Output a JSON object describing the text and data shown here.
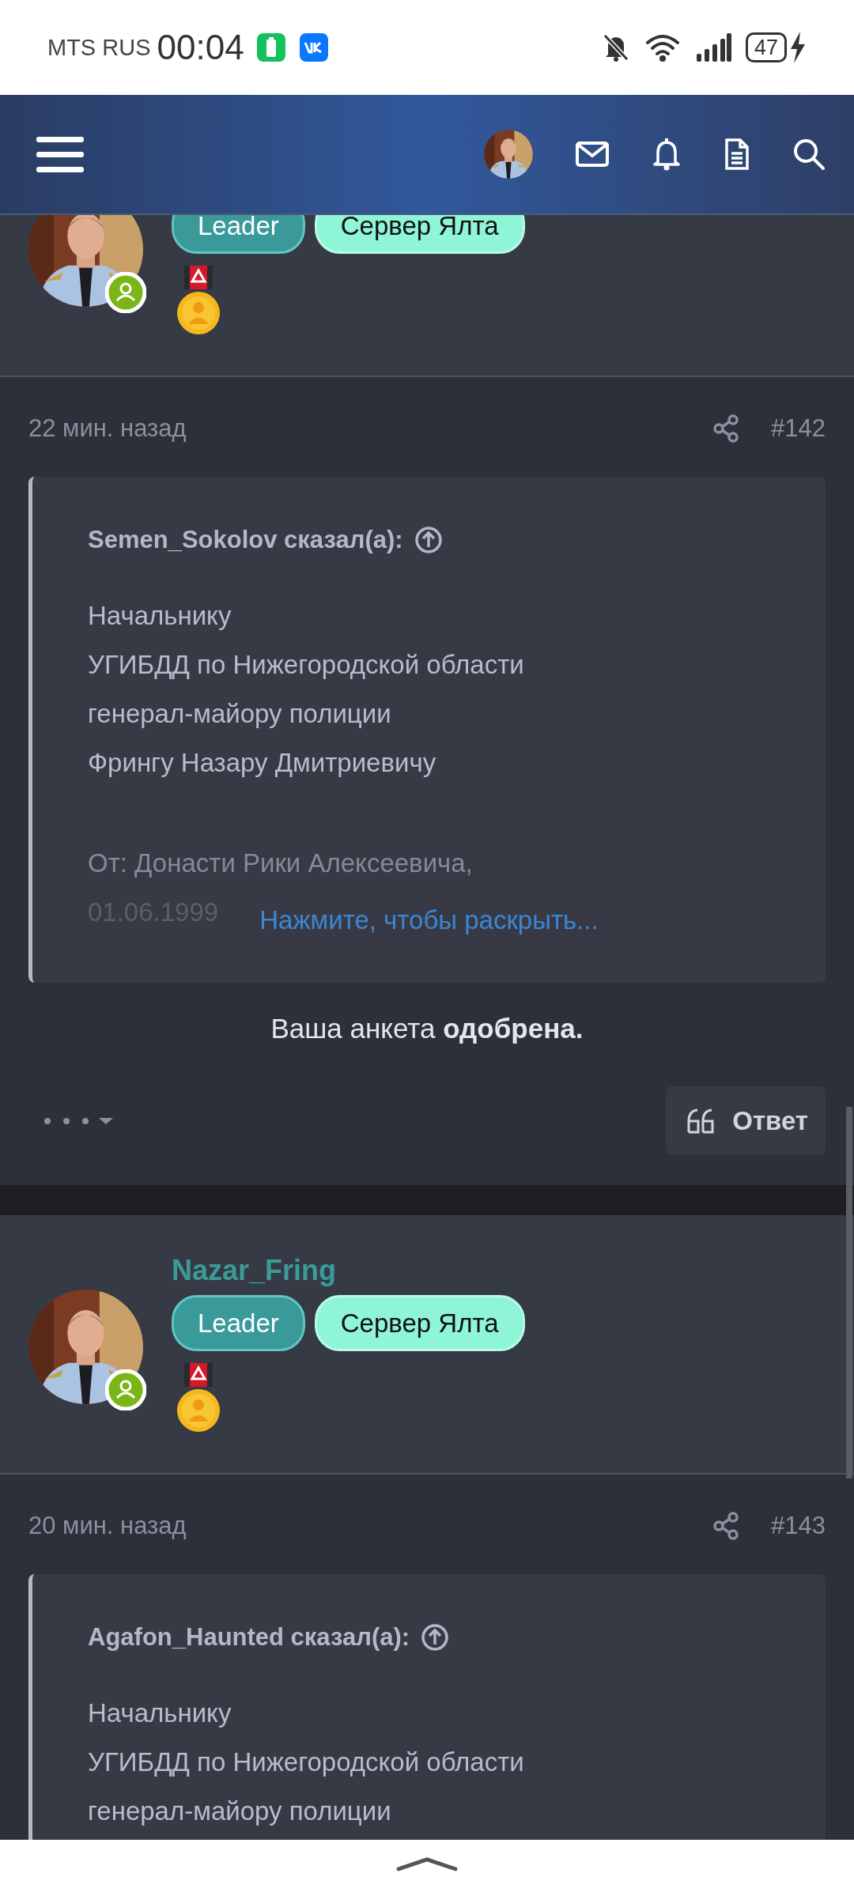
{
  "status_bar": {
    "carrier": "MTS RUS",
    "time": "00:04",
    "battery": "47"
  },
  "posts": [
    {
      "user": {
        "badges": [
          {
            "label": "Leader",
            "kind": "role"
          },
          {
            "label": "Сервер Ялта",
            "kind": "server"
          }
        ]
      },
      "time": "22 мин. назад",
      "number": "#142",
      "quote": {
        "author": "Semen_Sokolov сказал(а):",
        "lines": [
          "Начальнику",
          "УГИБДД по Нижегородской области",
          "генерал-майору полиции",
          "Фрингу Назару Дмитриевичу"
        ],
        "faded_lines": [
          "От: Донасти Рики Алексеевича,",
          "01.06.1999"
        ],
        "expand": "Нажмите, чтобы раскрыть..."
      },
      "message": "Ваша анкета **одобрена.**",
      "reply": "Ответ"
    },
    {
      "user": {
        "name": "Nazar_Fring",
        "badges": [
          {
            "label": "Leader",
            "kind": "role"
          },
          {
            "label": "Сервер Ялта",
            "kind": "server"
          }
        ]
      },
      "time": "20 мин. назад",
      "number": "#143",
      "quote": {
        "author": "Agafon_Haunted сказал(а):",
        "lines": [
          "Начальнику",
          "УГИБДД по Нижегородской области",
          "генерал-майору полиции"
        ]
      }
    }
  ]
}
